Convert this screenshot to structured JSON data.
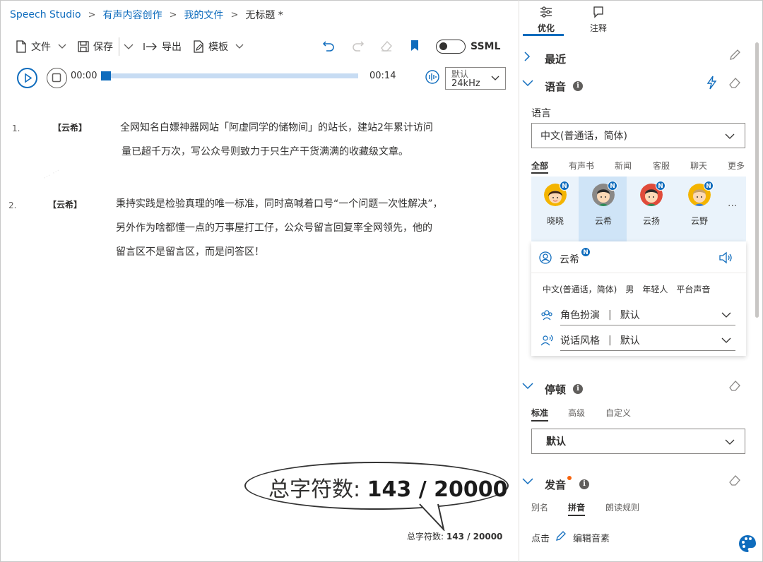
{
  "breadcrumb": {
    "app": "Speech Studio",
    "level1": "有声内容创作",
    "level2": "我的文件",
    "current": "无标题 *"
  },
  "toolbar": {
    "file": "文件",
    "save": "保存",
    "export": "导出",
    "template": "模板",
    "ssml": "SSML"
  },
  "player": {
    "current_time": "00:00",
    "total_time": "00:14",
    "progress": 0,
    "quality_top": "默认",
    "quality_bottom": "24kHz"
  },
  "paragraphs": [
    {
      "num": "1.",
      "speaker": "【云希】",
      "lines": [
        "全网知名白嫖神器网站「阿虚同学的储物间」的站长，建站2年累计访问",
        "量已超千万次，写公众号则致力于只生产干货满满的收藏级文章。"
      ]
    },
    {
      "num": "2.",
      "speaker": "【云希】",
      "lines": [
        "秉持实践是检验真理的唯一标准，同时高喊着口号“一个问题一次性解决”，",
        "另外作为啥都懂一点的万事屋打工仔，公众号留言回复率全网领先，他的",
        "留言区不是留言区，而是问答区！"
      ]
    }
  ],
  "char_count": {
    "label": "总字符数:",
    "value": "143 / 20000"
  },
  "right_panel": {
    "tabs": [
      "优化",
      "注释"
    ],
    "recent": "最近",
    "voice_section": "语音",
    "language_label": "语言",
    "language_value": "中文(普通话，简体)",
    "voice_categories": [
      "全部",
      "有声书",
      "新闻",
      "客服",
      "聊天",
      "更多"
    ],
    "voices": [
      {
        "name": "晓晓",
        "badge": "N"
      },
      {
        "name": "云希",
        "badge": "N"
      },
      {
        "name": "云扬",
        "badge": "N"
      },
      {
        "name": "云野",
        "badge": "N"
      }
    ],
    "more_voices": "···",
    "selected_voice": {
      "name": "云希",
      "badge": "N",
      "tags": [
        "中文(普通话，简体)",
        "男",
        "年轻人",
        "平台声音"
      ],
      "role_label": "角色扮演",
      "role_value": "默认",
      "style_label": "说话风格",
      "style_value": "默认",
      "divider": "|"
    },
    "pause_section": "停顿",
    "pause_tabs": [
      "标准",
      "高级",
      "自定义"
    ],
    "pause_value": "默认",
    "pron_section": "发音",
    "pron_tabs": [
      "别名",
      "拼音",
      "朗读规则"
    ],
    "pron_click": "点击",
    "pron_edit": "编辑音素"
  },
  "colors": {
    "accent": "#0f6cbd",
    "selected_voice_bg": "#cfe4f7",
    "voices_bg": "#eaf3fb",
    "pron_dot": "#f7630c"
  }
}
